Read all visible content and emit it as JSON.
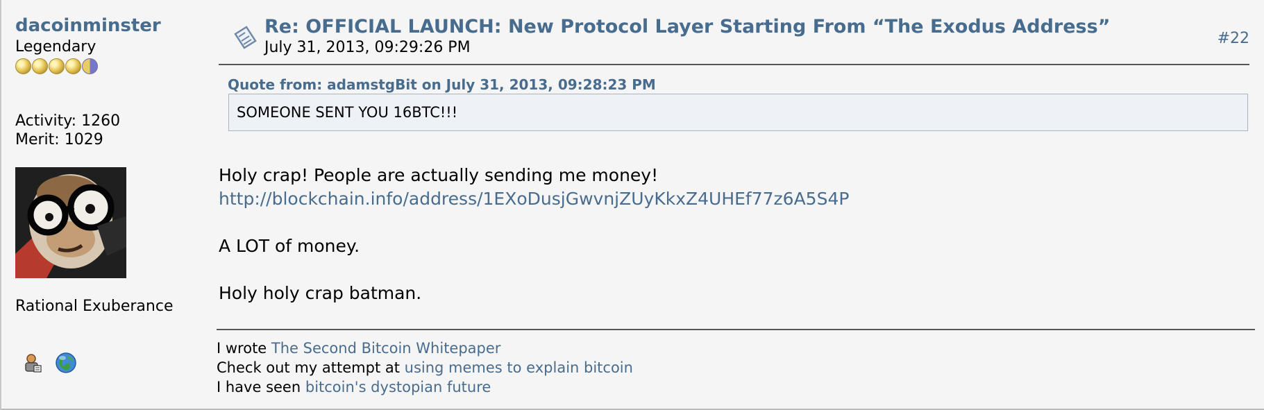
{
  "poster": {
    "name": "dacoinminster",
    "rank": "Legendary",
    "activity_label": "Activity:",
    "activity_value": "1260",
    "merit_label": "Merit:",
    "merit_value": "1029",
    "custom_title": "Rational Exuberance",
    "stars": {
      "full": 4,
      "half": 1
    },
    "icons": [
      "profile-icon",
      "website-globe-icon"
    ]
  },
  "post": {
    "subject": "Re: OFFICIAL LAUNCH: New Protocol Layer Starting From “The Exodus Address”",
    "date": "July 31, 2013, 09:29:26 PM",
    "number": "#22",
    "quote_header": "Quote from: adamstgBit on July 31, 2013, 09:28:23 PM",
    "quote_text": "SOMEONE SENT YOU 16BTC!!!",
    "body": {
      "line1": "Holy crap! People are actually sending me money!",
      "link": "http://blockchain.info/address/1EXoDusjGwvnjZUyKkxZ4UHEf77z6A5S4P",
      "line3": "A LOT of money.",
      "line4": "Holy holy crap batman."
    }
  },
  "signature": {
    "line1_prefix": "I wrote",
    "line1_link": "The Second Bitcoin Whitepaper",
    "line2_prefix": "Check out my attempt at",
    "line2_link": "using memes to explain bitcoin",
    "line3_prefix": "I have seen",
    "line3_link": "bitcoin's dystopian future"
  },
  "colors": {
    "link": "#476c8e",
    "background": "#f5f5f5",
    "quote_background": "#eef1f6"
  }
}
